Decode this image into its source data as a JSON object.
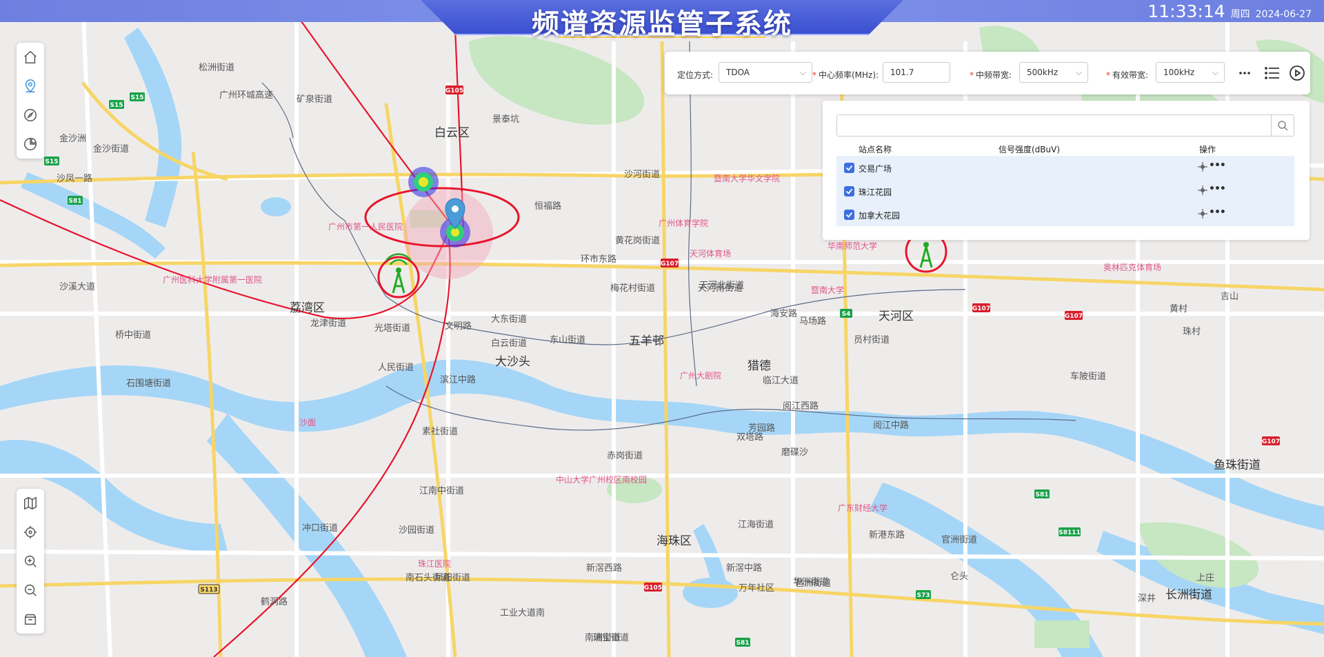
{
  "header": {
    "title": "频谱资源监管子系统",
    "time": "11:33:14",
    "weekday": "周四",
    "date": "2024-06-27"
  },
  "toolbar_top": [
    "home-icon",
    "location-pin-icon",
    "compass-icon",
    "pie-chart-icon"
  ],
  "toolbar_bottom": [
    "map-icon",
    "locate-icon",
    "zoom-in-icon",
    "zoom-out-icon",
    "layers-box-icon"
  ],
  "controls": {
    "method_label": "定位方式:",
    "method_value": "TDOA",
    "center_freq_label": "中心频率(MHz):",
    "center_freq_value": "101.7",
    "mid_bw_label": "中频带宽:",
    "mid_bw_value": "500kHz",
    "eff_bw_label": "有效带宽:",
    "eff_bw_value": "100kHz",
    "required_mark": "*"
  },
  "stations": {
    "search_placeholder": "",
    "col_name": "站点名称",
    "col_signal": "信号强度(dBuV)",
    "col_ops": "操作",
    "rows": [
      {
        "name": "交易广场",
        "signal": "",
        "checked": true
      },
      {
        "name": "珠江花园",
        "signal": "",
        "checked": true
      },
      {
        "name": "加拿大花园",
        "signal": "",
        "checked": true
      }
    ]
  },
  "map": {
    "districts": [
      "白云区",
      "荔湾区",
      "天河区",
      "海珠区",
      "五羊邨",
      "大沙头",
      "猎德",
      "鱼珠街道",
      "长洲街道"
    ],
    "labels": [
      "矿泉街道",
      "沙河街道",
      "景泰坑",
      "恒福路",
      "环市东路",
      "梅花村街道",
      "天河南街道",
      "大东街道",
      "东山街道",
      "白云街道",
      "人民街道",
      "龙津街道",
      "光塔街道",
      "文明路",
      "滨江中路",
      "素社街道",
      "赤岗街道",
      "江南中街道",
      "冲口街道",
      "沙园街道",
      "南石头街道",
      "凤阳街道",
      "新滘西路",
      "新滘中路",
      "江海街道",
      "琶洲街道",
      "官洲街道",
      "新港东路",
      "员村街道",
      "车陂街道",
      "黄村",
      "珠村",
      "吉山",
      "上庄",
      "深井",
      "仑头",
      "万年社区",
      "华洲街道",
      "芳园路",
      "磨碟沙",
      "双塔路",
      "临江大道",
      "阅江西路",
      "阅江中路",
      "黄花岗街道",
      "天河北街道",
      "海安路",
      "马场路",
      "石围塘街道",
      "桥中街道",
      "沙溪大道",
      "沙凤一路",
      "金沙洲",
      "金沙街道",
      "松洲街道",
      "广州环城高速",
      "鹤洞路",
      "工业大道南",
      "南洲街道",
      "瑞宝街道"
    ],
    "pois": [
      "广州市第一人民医院",
      "广州医科大学附属第一医院",
      "暨南大学华文学院",
      "广州体育学院",
      "天河体育场",
      "华南师范大学",
      "暨南大学",
      "广东财经大学",
      "中山大学广州校区南校园",
      "珠江医院",
      "广州大剧院",
      "奥林匹克体育场",
      "沙面"
    ],
    "road_shields": [
      "S15",
      "S15",
      "S15",
      "S81",
      "G105",
      "G107",
      "G107",
      "G107",
      "G107",
      "S4",
      "S81",
      "S8111",
      "S73",
      "G105",
      "S81",
      "S113"
    ],
    "colors": {
      "land": "#eeeceb",
      "water": "#a6d6f7",
      "green": "#c7e6c2",
      "major_road": "#f7d567",
      "ellipse": "#e8142c",
      "header": "#7486e4",
      "checkbox": "#3d6fe0"
    }
  }
}
